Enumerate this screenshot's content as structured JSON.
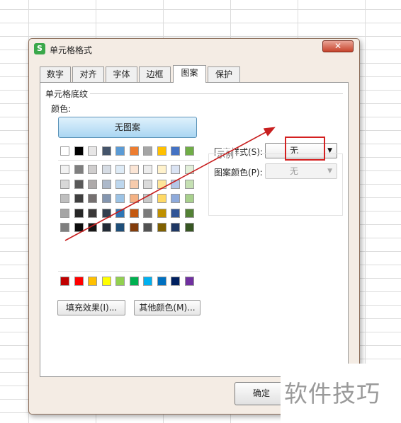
{
  "dialog": {
    "title": "单元格格式",
    "app_icon_letter": "S",
    "close_glyph": "✕"
  },
  "tabs": [
    {
      "label": "数字",
      "active": false
    },
    {
      "label": "对齐",
      "active": false
    },
    {
      "label": "字体",
      "active": false
    },
    {
      "label": "边框",
      "active": false
    },
    {
      "label": "图案",
      "active": true
    },
    {
      "label": "保护",
      "active": false
    }
  ],
  "shading": {
    "group_label": "单元格底纹",
    "color_label": "颜色:",
    "no_pattern_button": "无图案",
    "theme_colors": [
      "#ffffff",
      "#000000",
      "#e7e6e6",
      "#44546a",
      "#5b9bd5",
      "#ed7d31",
      "#a5a5a5",
      "#ffc000",
      "#4472c4",
      "#70ad47"
    ],
    "tint_rows": [
      [
        "#f2f2f2",
        "#7f7f7f",
        "#d0cece",
        "#d6dce4",
        "#deebf6",
        "#fbe5d5",
        "#ededed",
        "#fff2cc",
        "#dae3f3",
        "#e2efd9"
      ],
      [
        "#d8d8d8",
        "#595959",
        "#aeaaaa",
        "#adb9ca",
        "#bdd7ee",
        "#f7cbac",
        "#dbdbdb",
        "#fee599",
        "#b4c6e7",
        "#c5e0b3"
      ],
      [
        "#bfbfbf",
        "#3f3f3f",
        "#757070",
        "#8496b0",
        "#9cc3e5",
        "#f4b183",
        "#c9c9c9",
        "#ffd965",
        "#8eaadb",
        "#a8d08d"
      ],
      [
        "#a5a5a5",
        "#262626",
        "#3a3838",
        "#323f4f",
        "#2e75b5",
        "#c45911",
        "#7b7b7b",
        "#bf9000",
        "#2f5496",
        "#538135"
      ],
      [
        "#7f7f7f",
        "#0c0c0c",
        "#171616",
        "#222a35",
        "#1e4e79",
        "#833c0b",
        "#525252",
        "#7f6000",
        "#1f3864",
        "#375623"
      ]
    ],
    "standard_colors": [
      "#c00000",
      "#ff0000",
      "#ffc000",
      "#ffff00",
      "#92d050",
      "#00b050",
      "#00b0f0",
      "#0070c0",
      "#002060",
      "#7030a0"
    ],
    "fill_effects_button": "填充效果(I)...",
    "more_colors_button": "其他颜色(M)..."
  },
  "pattern": {
    "style_label": "图案样式(S):",
    "style_value": "无",
    "color_label": "图案颜色(P):",
    "color_value": "无",
    "sample_label": "示例"
  },
  "footer": {
    "ok_button": "确定"
  },
  "watermark": "软件技巧",
  "annotation": {
    "highlight_color": "#d42020",
    "arrow_color": "#c81e1e"
  }
}
